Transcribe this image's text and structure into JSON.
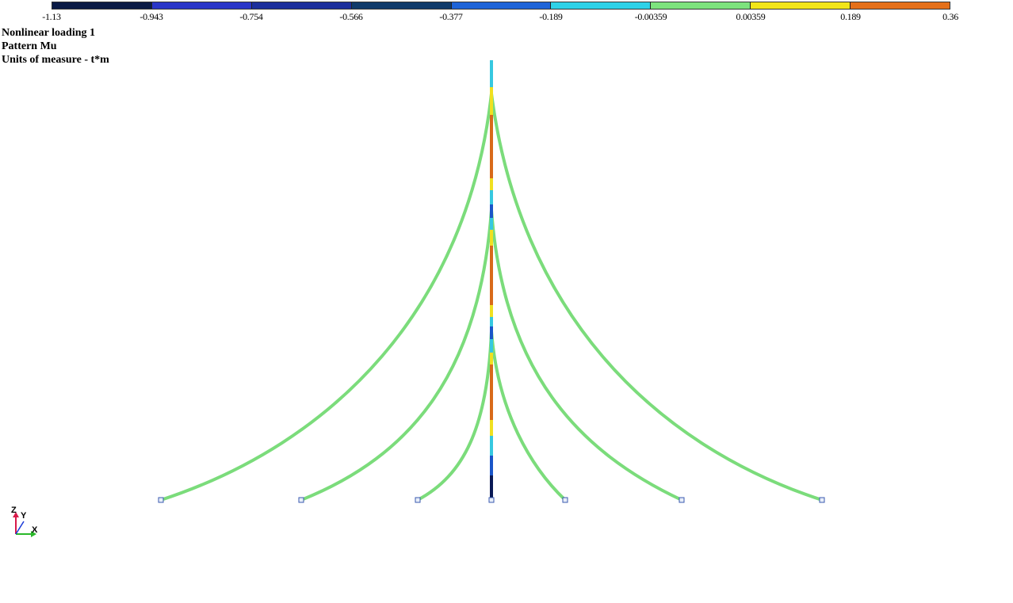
{
  "legend": {
    "ticks": [
      "-1.13",
      "-0.943",
      "-0.754",
      "-0.566",
      "-0.377",
      "-0.189",
      "-0.00359",
      "0.00359",
      "0.189",
      "0.36"
    ],
    "colors": [
      "#0a1a45",
      "#2a36c8",
      "#1c2f9c",
      "#0f3a6a",
      "#1f64d8",
      "#2fd2e8",
      "#7de37d",
      "#f2e51a",
      "#e5701a"
    ]
  },
  "info": {
    "line1": "Nonlinear loading 1",
    "line2": "Pattern Mu",
    "line3": "Units of measure - t*m"
  },
  "axes": {
    "z": "Z",
    "y": "Y",
    "x": "X"
  },
  "colors": {
    "member_green": "#7bdc7b",
    "mast_cyan": "#36c8e0",
    "mast_yellow": "#f0e020",
    "mast_orange": "#d86a1a",
    "mast_blue": "#1a55c8",
    "mast_dark": "#0a1a55",
    "support": "#3a5ab0"
  }
}
